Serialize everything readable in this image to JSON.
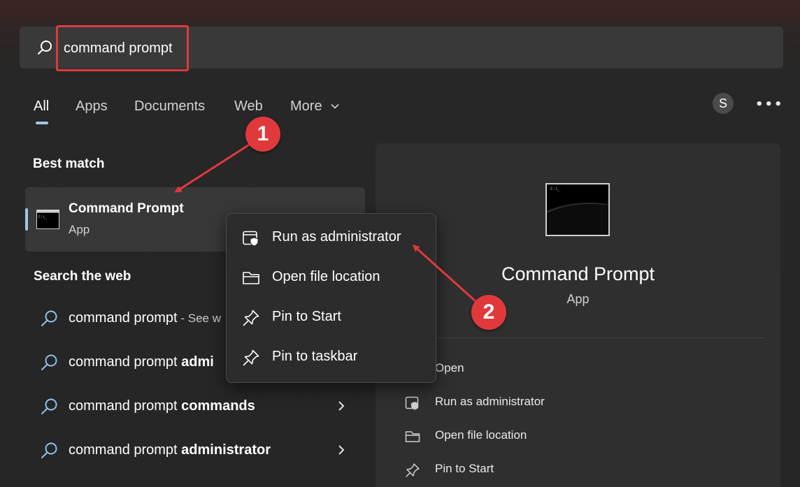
{
  "search": {
    "value": "command prompt",
    "highlight_color": "#e0393c"
  },
  "tabs": [
    {
      "label": "All",
      "active": true
    },
    {
      "label": "Apps"
    },
    {
      "label": "Documents"
    },
    {
      "label": "Web"
    },
    {
      "label": "More"
    }
  ],
  "account": {
    "initial": "S"
  },
  "more_options_icon": "ellipsis-icon",
  "best_match": {
    "heading": "Best match",
    "title": "Command Prompt",
    "subtitle": "App",
    "icon": "command-prompt-icon"
  },
  "search_web": {
    "heading": "Search the web",
    "items": [
      {
        "query": "command prompt",
        "suffix": " - See w"
      },
      {
        "query": "command prompt ",
        "bold": "admi"
      },
      {
        "query": "command prompt ",
        "bold": "commands"
      },
      {
        "query": "command prompt ",
        "bold": "administrator"
      }
    ]
  },
  "context_menu": {
    "items": [
      {
        "label": "Run as administrator",
        "icon": "shield-admin-icon"
      },
      {
        "label": "Open file location",
        "icon": "folder-icon"
      },
      {
        "label": "Pin to Start",
        "icon": "pin-icon"
      },
      {
        "label": "Pin to taskbar",
        "icon": "pin-icon"
      }
    ]
  },
  "detail_pane": {
    "title": "Command Prompt",
    "subtitle": "App",
    "icon_prompt": "C:\\_",
    "actions": [
      {
        "label": "Open",
        "icon": "open-icon"
      },
      {
        "label": "Run as administrator",
        "icon": "shield-admin-icon"
      },
      {
        "label": "Open file location",
        "icon": "folder-icon"
      },
      {
        "label": "Pin to Start",
        "icon": "pin-icon"
      }
    ]
  },
  "annotations": {
    "badge1": "1",
    "badge2": "2",
    "color": "#e0393c"
  },
  "colors": {
    "accent": "#9fc7e6",
    "panel": "#2f2f2f",
    "menu": "#2c2c2c"
  }
}
